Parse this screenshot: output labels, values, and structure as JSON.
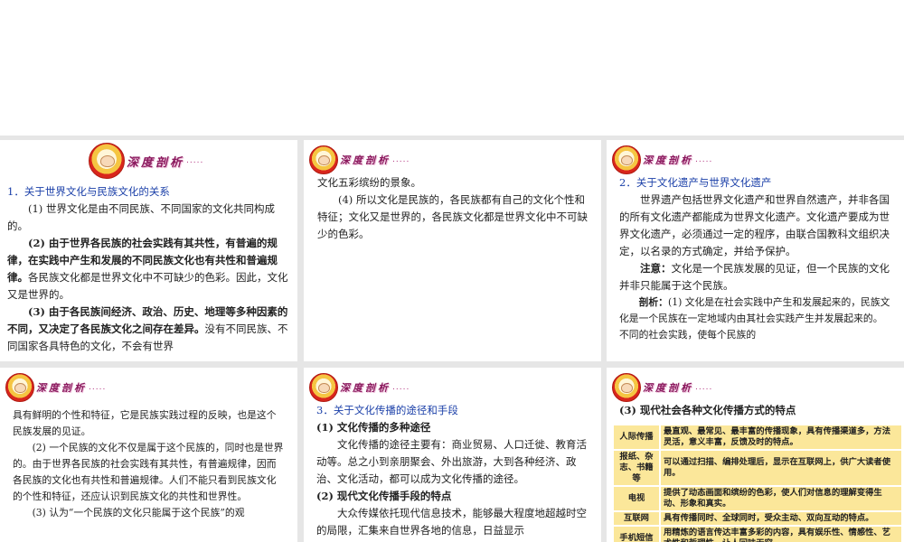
{
  "logo": {
    "text": "深度剖析",
    "dots": "....."
  },
  "s1": {
    "heading": "1．关于世界文化与民族文化的关系",
    "p1": "(1) 世界文化是由不同民族、不同国家的文化共同构成的。",
    "p2_bold": "(2) 由于世界各民族的社会实践有其共性，有普遍的规律，在实践中产生和发展的不同民族文化也有共性和普遍规律。",
    "p2_rest": "各民族文化都是世界文化中不可缺少的色彩。因此，文化又是世界的。",
    "p3_bold": "(3) 由于各民族间经济、政治、历史、地理等多种因素的不同，又决定了各民族文化之间存在差异。",
    "p3_rest": "没有不同民族、不同国家各具特色的文化，不会有世界"
  },
  "s2": {
    "p1": "文化五彩缤纷的景象。",
    "p2": "(4) 所以文化是民族的，各民族都有自己的文化个性和特征；文化又是世界的，各民族文化都是世界文化中不可缺少的色彩。"
  },
  "s3": {
    "heading": "2．关于文化遗产与世界文化遗产",
    "p1": "世界遗产包括世界文化遗产和世界自然遗产，并非各国的所有文化遗产都能成为世界文化遗产。文化遗产要成为世界文化遗产，必须通过一定的程序，由联合国教科文组织决定，以名录的方式确定，并给予保护。",
    "note_label": "注意：",
    "note": "文化是一个民族发展的见证，但一个民族的文化并非只能属于这个民族。",
    "analysis_label": "剖析：",
    "analysis": "(1) 文化是在社会实践中产生和发展起来的，民族文化是一个民族在一定地域内由其社会实践产生并发展起来的。不同的社会实践，使每个民族的"
  },
  "s4": {
    "p1": "具有鲜明的个性和特征，它是民族实践过程的反映，也是这个民族发展的见证。",
    "p2": "(2) 一个民族的文化不仅是属于这个民族的，同时也是世界的。由于世界各民族的社会实践有其共性，有普遍规律，因而各民族的文化也有共性和普遍规律。人们不能只看到民族文化的个性和特征，还应认识到民族文化的共性和世界性。",
    "p3": "(3) 认为“一个民族的文化只能属于这个民族”的观"
  },
  "s5": {
    "heading": "3．关于文化传播的途径和手段",
    "sub1": "(1) 文化传播的多种途径",
    "p1": "文化传播的途径主要有：商业贸易、人口迁徙、教育活动等。总之小到亲朋聚会、外出旅游，大到各种经济、政治、文化活动，都可以成为文化传播的途径。",
    "sub2": "(2) 现代文化传播手段的特点",
    "p2": "大众传媒依托现代信息技术，能够最大程度地超越时空的局限，汇集来自世界各地的信息，日益显示"
  },
  "s6": {
    "heading": "(3) 现代社会各种文化传播方式的特点",
    "rows": [
      {
        "name": "人际传播",
        "desc": "最直观、最常见、最丰富的传播现象，具有传播渠道多，方法灵活，意义丰富，反馈及时的特点。"
      },
      {
        "name": "报纸、杂志、书籍等",
        "desc": "可以通过扫描、编排处理后，显示在互联网上，供广大读者使用。"
      },
      {
        "name": "电视",
        "desc": "提供了动态画面和缤纷的色彩，使人们对信息的理解变得生动、形象和真实。"
      },
      {
        "name": "互联网",
        "desc": "具有传播同时、全球同时，受众主动、双向互动的特点。"
      },
      {
        "name": "手机短信",
        "desc": "用精炼的语言传达丰富多彩的内容，具有娱乐性、情感性、艺术性和哲理性，让人回味无穷。"
      }
    ]
  }
}
